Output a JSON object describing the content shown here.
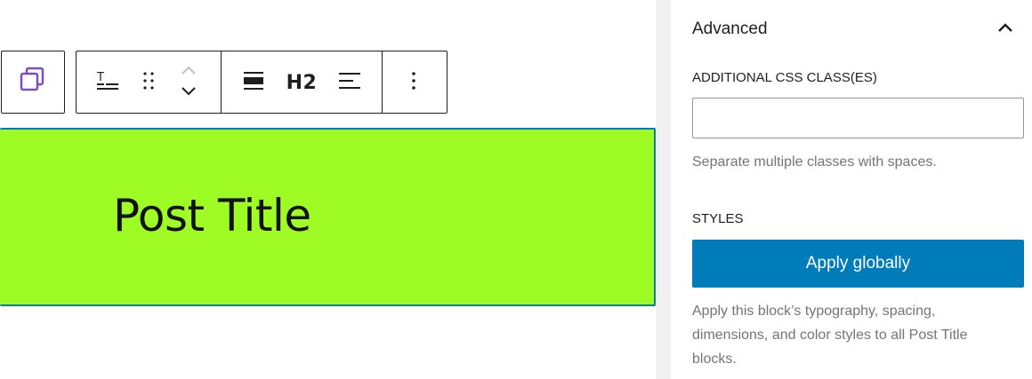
{
  "toolbar": {
    "heading_level": "H2"
  },
  "block": {
    "text": "Post Title",
    "background_color": "#9efb24"
  },
  "sidebar": {
    "panel_title": "Advanced",
    "css_class": {
      "label": "ADDITIONAL CSS CLASS(ES)",
      "value": "",
      "help": "Separate multiple classes with spaces."
    },
    "styles": {
      "label": "STYLES",
      "button_label": "Apply globally",
      "help": "Apply this block’s typography, spacing, dimensions, and color styles to all Post Title blocks."
    }
  },
  "colors": {
    "accent": "#007cba",
    "parent_icon": "#7b4fc0"
  }
}
